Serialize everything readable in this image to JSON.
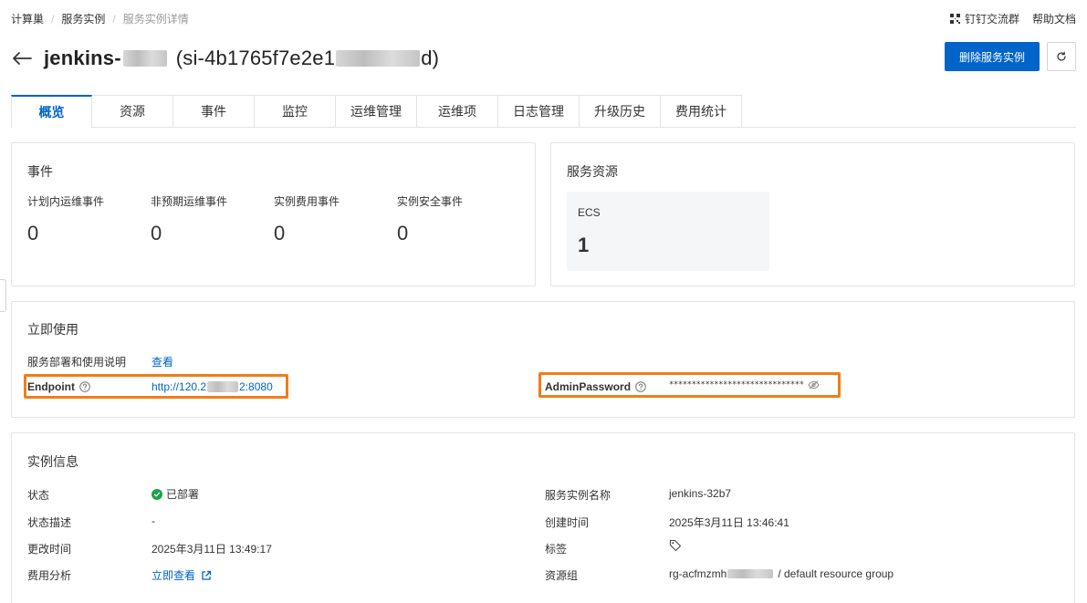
{
  "breadcrumb": {
    "items": [
      "计算巢",
      "服务实例",
      "服务实例详情"
    ],
    "separator": "/"
  },
  "top_links": {
    "dingtalk": "钉钉交流群",
    "help": "帮助文档"
  },
  "title": {
    "name": "jenkins-",
    "open_paren": "(si-4b1765f7e2e1",
    "close_paren": "d)"
  },
  "actions": {
    "delete": "删除服务实例"
  },
  "tabs": [
    "概览",
    "资源",
    "事件",
    "监控",
    "运维管理",
    "运维项",
    "日志管理",
    "升级历史",
    "费用统计"
  ],
  "active_tab": "概览",
  "events": {
    "title": "事件",
    "metrics": [
      {
        "label": "计划内运维事件",
        "value": "0"
      },
      {
        "label": "非预期运维事件",
        "value": "0"
      },
      {
        "label": "实例费用事件",
        "value": "0"
      },
      {
        "label": "实例安全事件",
        "value": "0"
      }
    ]
  },
  "resources": {
    "title": "服务资源",
    "ecs_label": "ECS",
    "ecs_value": "1"
  },
  "use": {
    "title": "立即使用",
    "guide_label": "服务部署和使用说明",
    "guide_link": "查看",
    "endpoint_label": "Endpoint",
    "endpoint_prefix": "http://120.2",
    "endpoint_suffix": "2:8080",
    "admin_label": "AdminPassword",
    "admin_value": "******************************"
  },
  "info": {
    "title": "实例信息",
    "status_label": "状态",
    "status_value": "已部署",
    "status_desc_label": "状态描述",
    "status_desc_value": "-",
    "modified_label": "更改时间",
    "modified_value": "2025年3月11日 13:49:17",
    "billing_label": "费用分析",
    "billing_link": "立即查看",
    "name_label": "服务实例名称",
    "name_value": "jenkins-32b7",
    "created_label": "创建时间",
    "created_value": "2025年3月11日 13:46:41",
    "tags_label": "标签",
    "rg_label": "资源组",
    "rg_prefix": "rg-acfmzmh",
    "rg_suffix": "/ default resource group"
  },
  "colors": {
    "primary": "#0064c8",
    "highlight": "#f07d1a",
    "success": "#1ba34a"
  }
}
